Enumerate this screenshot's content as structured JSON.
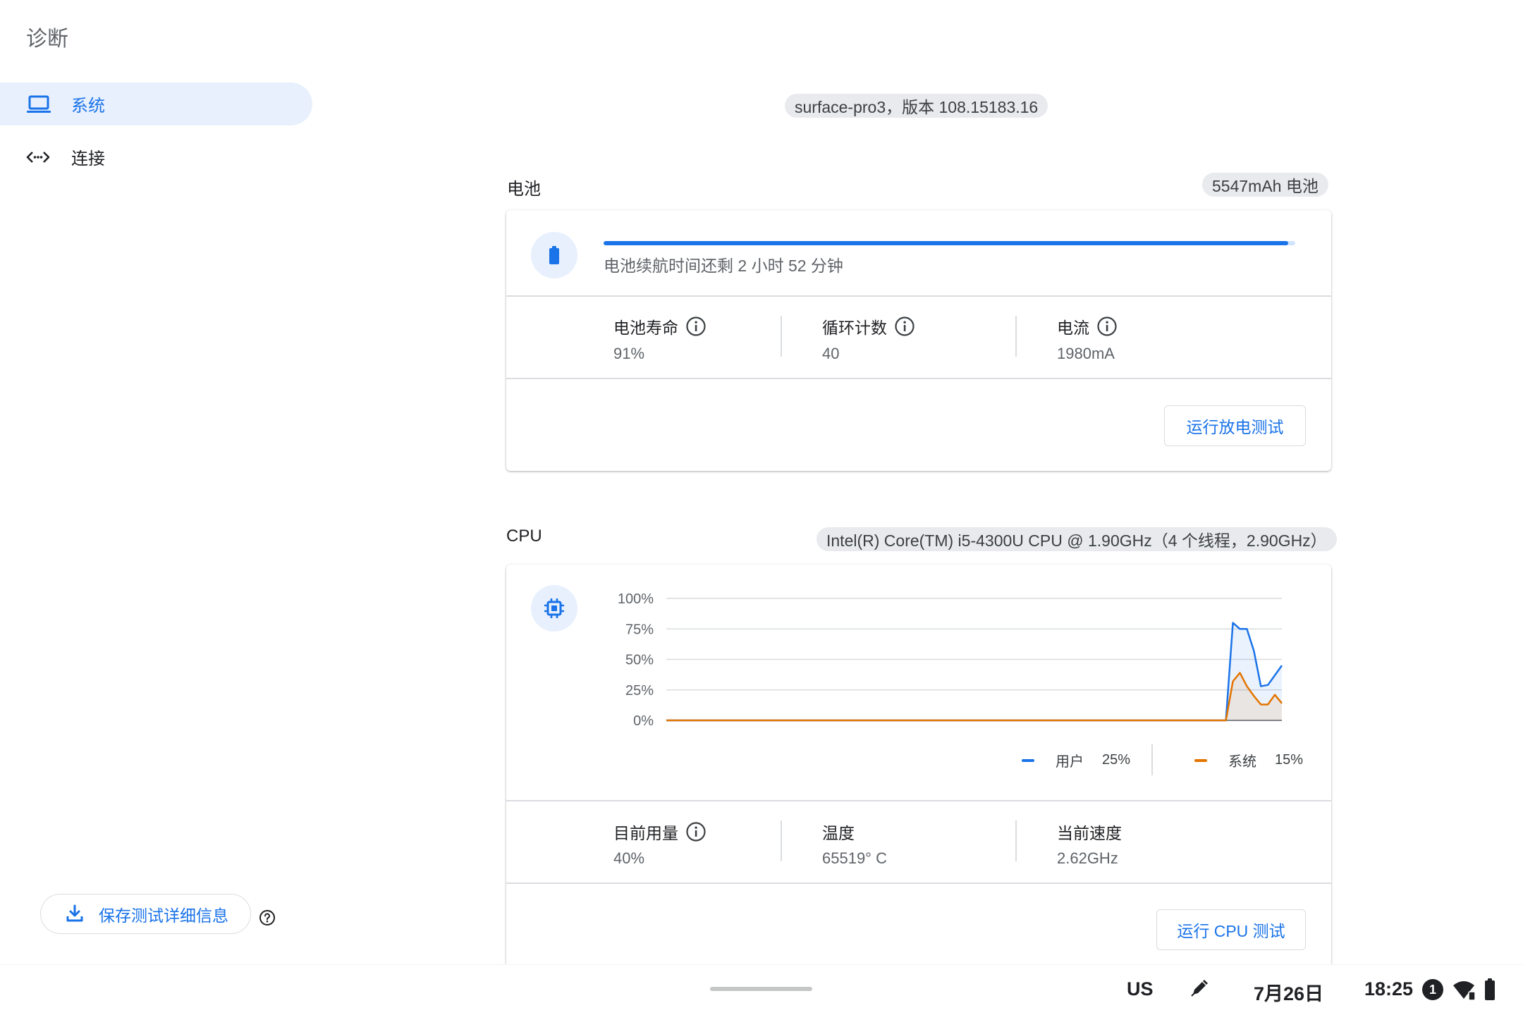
{
  "app": {
    "title": "诊断"
  },
  "sidebar": {
    "items": [
      {
        "label": "系统",
        "icon": "laptop-icon",
        "active": true
      },
      {
        "label": "连接",
        "icon": "connectivity-icon",
        "active": false
      }
    ],
    "save_label": "保存测试详细信息"
  },
  "device": {
    "info": "surface-pro3，版本 108.15183.16"
  },
  "battery": {
    "title": "电池",
    "capacity": "5547mAh 电池",
    "charge_fraction": 0.99,
    "status": "电池续航时间还剩 2 小时 52 分钟",
    "stats": [
      {
        "label": "电池寿命",
        "value": "91%"
      },
      {
        "label": "循环计数",
        "value": "40"
      },
      {
        "label": "电流",
        "value": "1980mA"
      }
    ],
    "run_label": "运行放电测试"
  },
  "cpu": {
    "title": "CPU",
    "model": "Intel(R) Core(TM) i5-4300U CPU @ 1.90GHz（4 个线程，2.90GHz）",
    "legend": [
      {
        "name": "用户",
        "value": "25%",
        "color": "#1a73e8"
      },
      {
        "name": "系统",
        "value": "15%",
        "color": "#e37400"
      }
    ],
    "stats": [
      {
        "label": "目前用量",
        "value": "40%"
      },
      {
        "label": "温度",
        "value": "65519° C"
      },
      {
        "label": "当前速度",
        "value": "2.62GHz"
      }
    ],
    "run_label": "运行 CPU 测试"
  },
  "chart_data": {
    "type": "line",
    "yticks": [
      "100%",
      "75%",
      "50%",
      "25%",
      "0%"
    ],
    "ylim": [
      0,
      100
    ],
    "series": [
      {
        "name": "用户",
        "color": "#1a73e8",
        "values": [
          0,
          0,
          0,
          0,
          0,
          0,
          0,
          0,
          0,
          0,
          0,
          0,
          0,
          0,
          0,
          0,
          0,
          0,
          0,
          0,
          0,
          0,
          0,
          0,
          0,
          0,
          0,
          0,
          0,
          0,
          0,
          0,
          0,
          0,
          0,
          0,
          0,
          0,
          0,
          0,
          0,
          0,
          0,
          0,
          0,
          0,
          0,
          0,
          0,
          0,
          0,
          0,
          0,
          0,
          0,
          0,
          0,
          0,
          0,
          0,
          0,
          0,
          0,
          0,
          0,
          0,
          0,
          0,
          0,
          0,
          0,
          0,
          0,
          0,
          0,
          0,
          0,
          0,
          0,
          0,
          0,
          80,
          75,
          75,
          57,
          28,
          29,
          37,
          45
        ]
      },
      {
        "name": "系统",
        "color": "#e37400",
        "values": [
          0,
          0,
          0,
          0,
          0,
          0,
          0,
          0,
          0,
          0,
          0,
          0,
          0,
          0,
          0,
          0,
          0,
          0,
          0,
          0,
          0,
          0,
          0,
          0,
          0,
          0,
          0,
          0,
          0,
          0,
          0,
          0,
          0,
          0,
          0,
          0,
          0,
          0,
          0,
          0,
          0,
          0,
          0,
          0,
          0,
          0,
          0,
          0,
          0,
          0,
          0,
          0,
          0,
          0,
          0,
          0,
          0,
          0,
          0,
          0,
          0,
          0,
          0,
          0,
          0,
          0,
          0,
          0,
          0,
          0,
          0,
          0,
          0,
          0,
          0,
          0,
          0,
          0,
          0,
          0,
          0,
          32,
          39,
          28,
          20,
          13,
          13,
          21,
          14
        ]
      }
    ]
  },
  "shelf": {
    "ime": "US",
    "date": "7月26日",
    "time": "18:25",
    "notification_count": "1"
  }
}
